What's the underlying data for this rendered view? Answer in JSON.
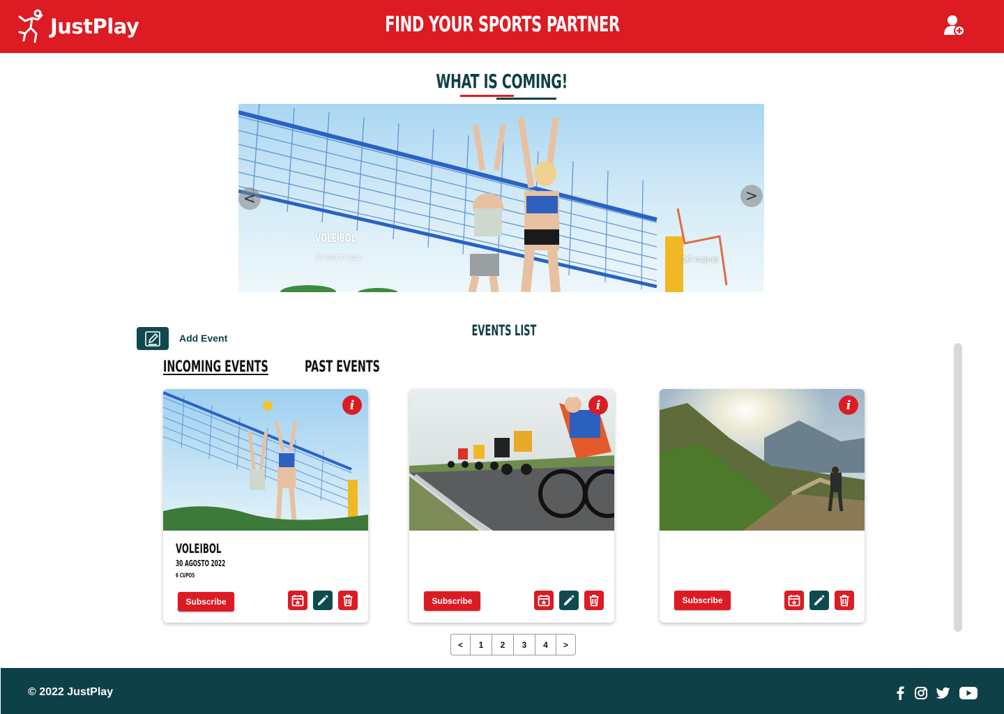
{
  "header": {
    "brand": "JustPlay",
    "title": "FIND YOUR SPORTS PARTNER"
  },
  "featured": {
    "title": "WHAT IS COMING!",
    "slide": {
      "name": "VOLEIBOL",
      "date": "30 AGOSTO 2022",
      "slots": "10 cupos"
    },
    "prev_label": "<",
    "next_label": ">"
  },
  "events": {
    "add_label": "Add Event",
    "list_title": "EVENTS LIST",
    "tabs": [
      {
        "label": "INCOMING EVENTS",
        "active": true
      },
      {
        "label": "PAST EVENTS",
        "active": false
      }
    ],
    "cards": [
      {
        "name": "VOLEIBOL",
        "date": "30 AGOSTO 2022",
        "slots": "6 CUPOS",
        "subscribe": "Subscribe",
        "info": "i"
      },
      {
        "name": "",
        "date": "",
        "slots": "",
        "subscribe": "Subscribe",
        "info": "i"
      },
      {
        "name": "",
        "date": "",
        "slots": "",
        "subscribe": "Subscribe",
        "info": "i"
      }
    ]
  },
  "pagination": {
    "prev": "<",
    "pages": [
      "1",
      "2",
      "3",
      "4"
    ],
    "next": ">"
  },
  "footer": {
    "copyright": "© 2022 JustPlay",
    "social": [
      "facebook-icon",
      "instagram-icon",
      "twitter-icon",
      "youtube-icon"
    ]
  },
  "colors": {
    "brand_red": "#dc1b23",
    "brand_teal": "#0e4047"
  }
}
